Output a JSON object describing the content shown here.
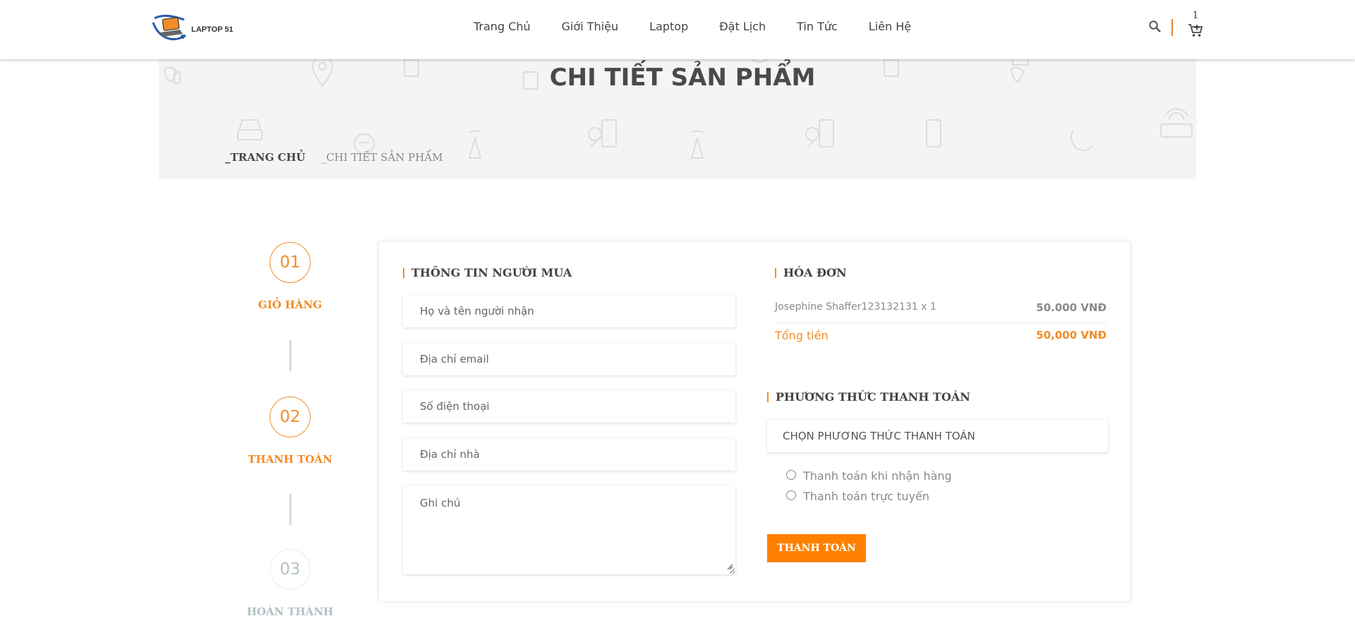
{
  "header": {
    "logo_text": "LAPTOP 51",
    "nav": [
      "Trang Chủ",
      "Giới Thiệu",
      "Laptop",
      "Đặt Lịch",
      "Tin Tức",
      "Liên Hệ"
    ],
    "cart_count": "1",
    "accent_color": "#f28c28"
  },
  "banner": {
    "title": "CHI TIẾT SẢN PHẨM",
    "breadcrumb": [
      "_TRANG CHỦ",
      "_CHI TIẾT SẢN PHẨM"
    ]
  },
  "steps": [
    {
      "number": "01",
      "label": "GIỎ HÀNG",
      "state": "active"
    },
    {
      "number": "02",
      "label": "THANH TOÁN",
      "state": "active"
    },
    {
      "number": "03",
      "label": "HOÀN THÀNH",
      "state": "inactive"
    }
  ],
  "buyer": {
    "title": "THÔNG TIN NGƯỜI MUA",
    "fields": [
      {
        "placeholder": "Họ và tên người nhận",
        "value": ""
      },
      {
        "placeholder": "Địa chỉ email",
        "value": ""
      },
      {
        "placeholder": "Số điện thoại",
        "value": ""
      },
      {
        "placeholder": "Địa chỉ nhà",
        "value": ""
      },
      {
        "placeholder": "Ghi chú",
        "value": ""
      }
    ]
  },
  "invoice": {
    "title": "HÓA ĐƠN",
    "items": [
      {
        "name": "Josephine Shaffer123132131 x 1",
        "price": "50.000 VNĐ"
      }
    ],
    "total_label": "Tổng tiền",
    "total_value": "50,000 VNĐ"
  },
  "payment": {
    "title": "PHƯƠNG THỨC THANH TOÁN",
    "select_label": "CHỌN PHƯƠNG THỨC THANH TOÁN",
    "options": [
      "Thanh toán khi nhận hàng",
      "Thanh toán trực tuyến"
    ],
    "button_label": "THANH TOÁN",
    "button_color": "#ff8000"
  }
}
